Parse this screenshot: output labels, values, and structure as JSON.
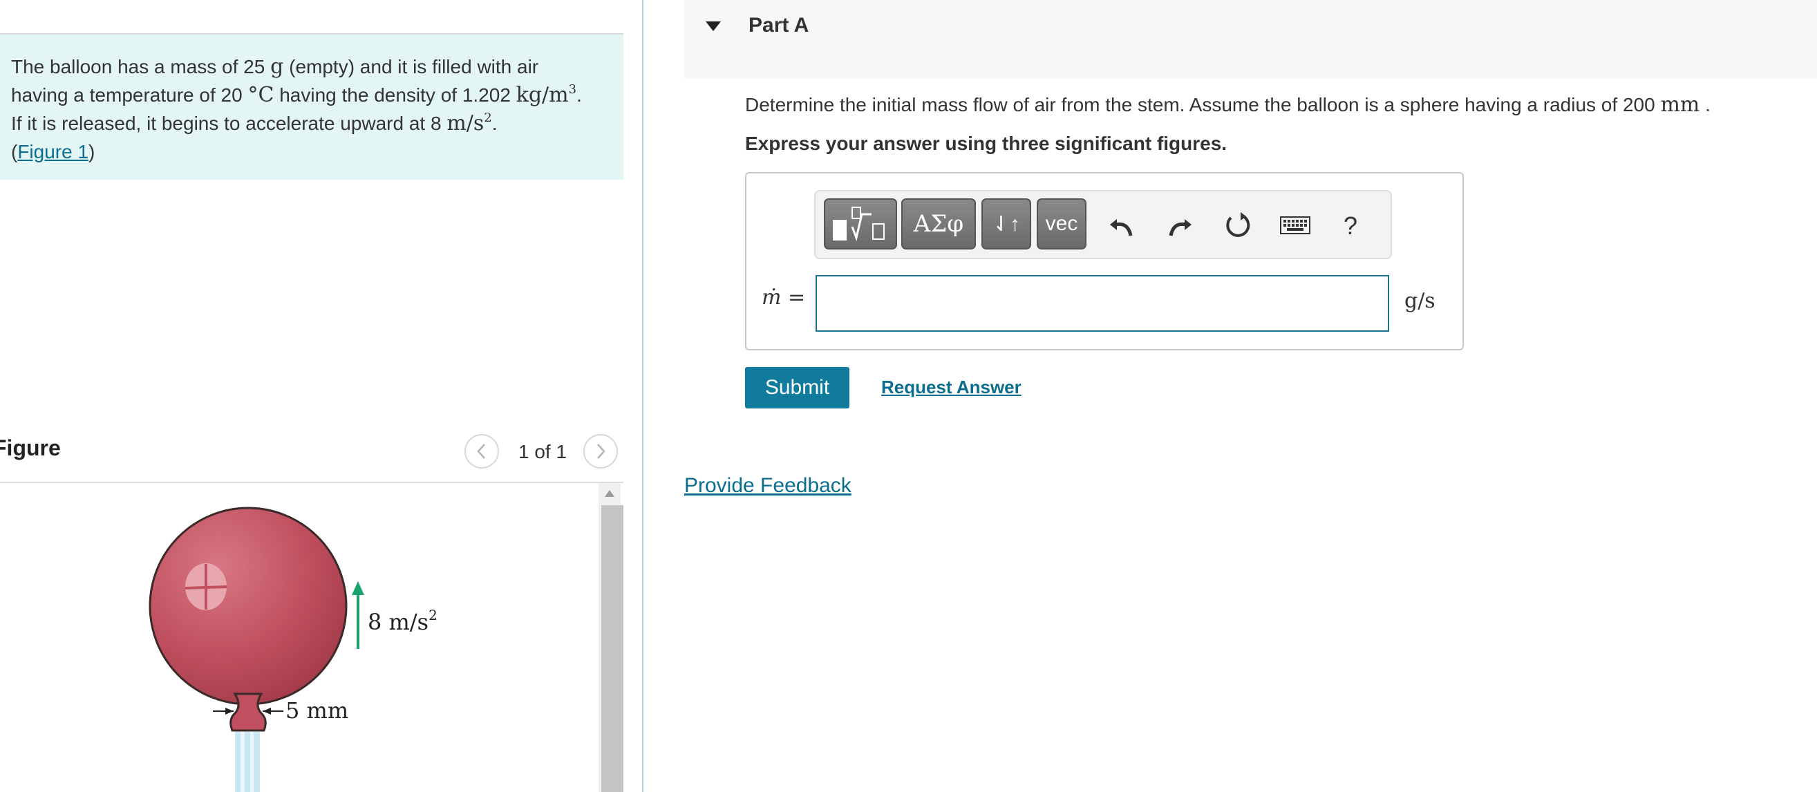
{
  "problem": {
    "line1_a": "The balloon has a mass of 25",
    "line1_unit": "g",
    "line1_b": "(empty) and it is filled with air",
    "line2_a": "having a temperature of 20",
    "line2_unit": "°C",
    "line2_b": "having the density of 1.202",
    "line2_unit2": "kg/m",
    "line2_exp": "3",
    "line3_a": "If it is released, it begins to accelerate upward at 8",
    "line3_unit": "m/s",
    "line3_exp": "2",
    "figure_link": "Figure 1"
  },
  "figure": {
    "title": "Figure",
    "page_count": "1 of 1",
    "accel_label": "8 m/s",
    "accel_exp": "2",
    "stem_label": "5 mm"
  },
  "part": {
    "title": "Part A",
    "question_a": "Determine the initial mass flow of air from the stem. Assume the balloon is a sphere having a radius of 200",
    "question_unit": "mm",
    "instruction": "Express your answer using three significant figures."
  },
  "toolbar": {
    "greek_label": "ΑΣφ",
    "arrows_label": "⇃↑",
    "vec_label": "vec",
    "help_label": "?"
  },
  "answer": {
    "variable": "ṁ =",
    "value": "",
    "unit": "g/s"
  },
  "actions": {
    "submit_label": "Submit",
    "request_label": "Request Answer",
    "feedback_label": "Provide Feedback"
  },
  "colors": {
    "accent": "#117b9e",
    "link": "#0b6e8e",
    "intro_bg": "#e4f5f5",
    "balloon": "#c0505f",
    "arrow": "#1aa36b"
  }
}
